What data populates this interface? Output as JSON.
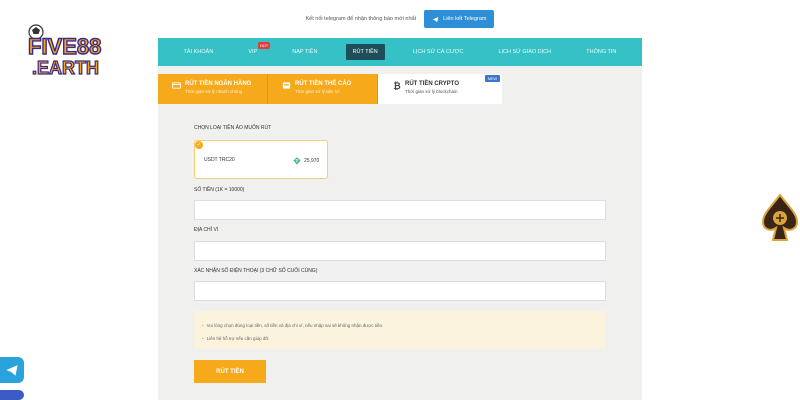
{
  "brand": {
    "logo_text": "FIVE88.EARTH",
    "accent_orange": "#f5a91b",
    "nav_teal": "#35c1c6"
  },
  "telegram_bar": {
    "text": "Kết nối telegram để nhận thông báo mới nhất",
    "button_label": "Liên kết Telegram"
  },
  "nav": {
    "items": [
      {
        "label": "TÀI KHOẢN",
        "active": false
      },
      {
        "label": "VIP",
        "active": false,
        "badge": "HOT"
      },
      {
        "label": "NẠP TIỀN",
        "active": false
      },
      {
        "label": "RÚT TIỀN",
        "active": true
      },
      {
        "label": "LỊCH SỬ CÁ CƯỢC",
        "active": false
      },
      {
        "label": "LỊCH SỬ GIAO DỊCH",
        "active": false
      },
      {
        "label": "THÔNG TIN",
        "active": false
      }
    ]
  },
  "tabs": [
    {
      "title": "RÚT TIỀN NGÂN HÀNG",
      "subtitle": "Thời gian xử lý nhanh chóng",
      "icon": "bank-card-icon",
      "active": false
    },
    {
      "title": "RÚT TIỀN THẺ CÀO",
      "subtitle": "Thời gian xử lý tiện lợi",
      "icon": "scratch-card-icon",
      "active": false
    },
    {
      "title": "RÚT TIỀN CRYPTO",
      "subtitle": "Thời gian xử lý blockchain",
      "icon": "bitcoin-icon",
      "active": true,
      "badge": "NEW"
    }
  ],
  "form": {
    "crypto_select_label": "CHỌN LOẠI TIỀN ẢO MUỐN RÚT",
    "crypto_option": {
      "name": "USDT TRC20",
      "amount": "25,970",
      "selected": true
    },
    "amount_label": "SỐ TIỀN (1K = 10000)",
    "address_label": "ĐỊA CHỈ VÍ",
    "phone_label": "XÁC NHẬN SỐ ĐIỆN THOẠI (3 CHỮ SỐ CUỐI CÙNG)",
    "amount_value": "",
    "address_value": "",
    "phone_value": "",
    "notices": [
      "Vui lòng chọn đúng loại tiền, số tiền và địa chỉ ví, nếu nhập sai sẽ không nhận được tiền.",
      "Liên hệ hỗ trợ nếu cần giúp đỡ."
    ],
    "submit_label": "RÚT TIỀN"
  }
}
